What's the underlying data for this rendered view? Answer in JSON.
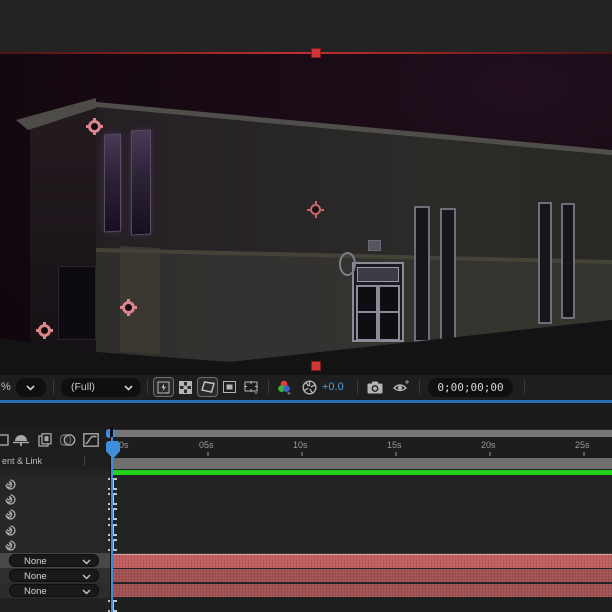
{
  "viewer": {
    "magnification_suffix": "%",
    "resolution_label": "(Full)",
    "exposure_value": "+0.0",
    "timecode": "0;00;00;00",
    "icons": [
      "magnification-chevron",
      "resolution-chevron",
      "fast-previews",
      "transparency-grid",
      "mask-shape-visibility",
      "region-of-interest",
      "grid-guide-options",
      "channel-settings",
      "reset-exposure",
      "snapshot-camera",
      "show-snapshot"
    ]
  },
  "timeline": {
    "columns_header": "ent & Link",
    "ruler_labels": [
      "00s",
      "05s",
      "10s",
      "15s",
      "20s",
      "25s"
    ],
    "parent_dropdowns": [
      "None",
      "None",
      "None"
    ],
    "pick_whip_row_count": 5,
    "icons": [
      "shy-layers",
      "frame-blending",
      "motion-blur",
      "graph-editor",
      "pick-whip"
    ],
    "colors": {
      "accent_blue": "#3f8edc",
      "panel_border_blue": "#2a6fb5",
      "green_layer_bar": "#23d11d",
      "red_layer_bar_selected": "#c26060",
      "red_layer_bar": "#a25252",
      "selection_red": "#d13537",
      "control_point_red": "#db868b",
      "work_area_gray": "#6f6f6f"
    }
  }
}
